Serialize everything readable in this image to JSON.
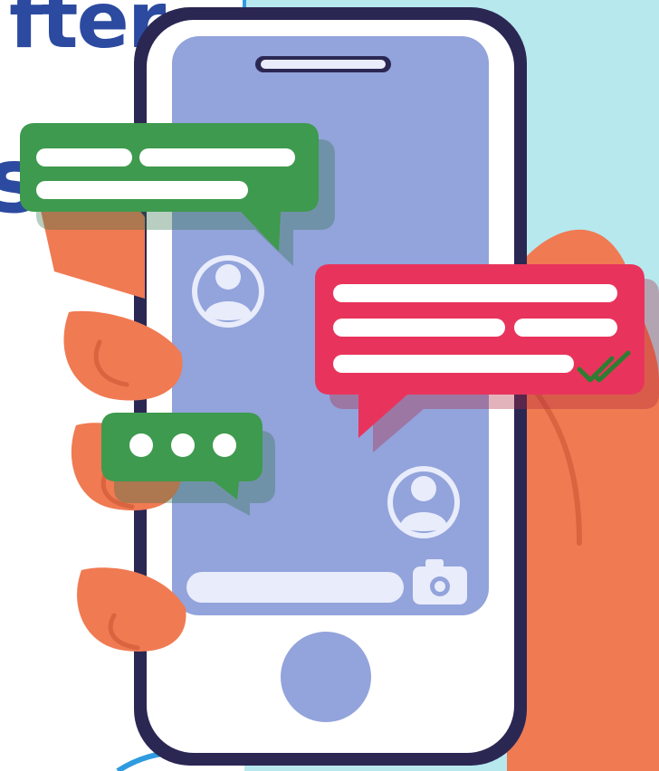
{
  "headline": {
    "line1": "fter",
    "line2": "s"
  },
  "colors": {
    "background_panel": "#b6e8ee",
    "headline_text": "#2b4aa0",
    "phone_frame": "#2b2753",
    "phone_screen": "#93a3db",
    "hand_skin": "#f07a52",
    "bubble_green": "#3e9a4e",
    "bubble_red": "#e8345c",
    "checkmark": "#2e7d32"
  },
  "icons": {
    "avatar_top": "user-avatar-icon",
    "avatar_bottom": "user-avatar-icon",
    "camera": "camera-icon",
    "typing": "typing-dots-icon",
    "read_receipt": "double-check-icon",
    "home_button": "home-button-icon"
  }
}
